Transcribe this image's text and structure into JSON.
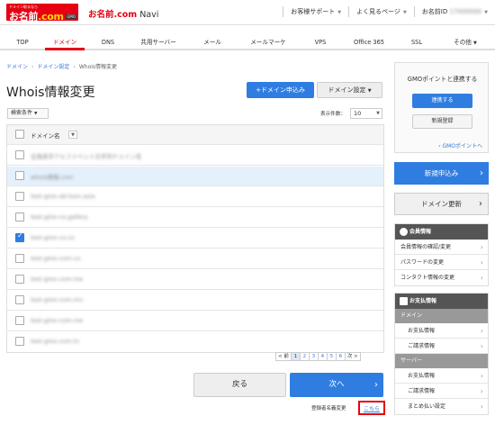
{
  "header": {
    "logo_tag": "ドメイン取るなら",
    "logo_main_a": "お名前",
    "logo_main_b": ".com",
    "logo_gmo": "GMO",
    "app_title_red": "お名前.com",
    "app_title_rest": " Navi",
    "links": [
      "お客様サポート",
      "よく見るページ",
      "お名前ID"
    ],
    "user_id": "17000000"
  },
  "nav": {
    "tabs": [
      "TOP",
      "ドメイン",
      "DNS",
      "共用サーバー",
      "メール",
      "メールマーケ",
      "VPS",
      "Office 365",
      "SSL",
      "その他"
    ],
    "active": "ドメイン"
  },
  "breadcrumb": [
    "ドメイン",
    "ドメイン設定",
    "Whois情報変更"
  ],
  "page_title": "Whois情報変更",
  "buttons": {
    "add_domain": "ドメイン申込み",
    "domain_settings": "ドメイン設定",
    "back": "戻る",
    "next": "次へ"
  },
  "filter": {
    "label": "検索条件",
    "count_label": "表示件数：",
    "count_value": "10"
  },
  "table": {
    "header": "ドメイン名",
    "rows": [
      {
        "name": "全角英字アルファベット文字列ドメイン名",
        "checked": false,
        "selected": false
      },
      {
        "name": "whois情報.com",
        "checked": false,
        "selected": true
      },
      {
        "name": "test-gmo-ab-tson.asia",
        "checked": false,
        "selected": false
      },
      {
        "name": "test-gmo-co.gallery",
        "checked": false,
        "selected": false
      },
      {
        "name": "test-gmo-co.co",
        "checked": true,
        "selected": false
      },
      {
        "name": "test-gmo-com.co",
        "checked": false,
        "selected": false
      },
      {
        "name": "test-gmo-com.me",
        "checked": false,
        "selected": false
      },
      {
        "name": "test-gmo-com.mn",
        "checked": false,
        "selected": false
      },
      {
        "name": "test-gmo-com.me",
        "checked": false,
        "selected": false
      },
      {
        "name": "test-gmo-com.tv",
        "checked": false,
        "selected": false
      }
    ]
  },
  "pagination": {
    "prev": "< 前",
    "pages": [
      "1",
      "2",
      "3",
      "4",
      "5",
      "6"
    ],
    "current": "1",
    "next": "次 >"
  },
  "change_note": "登録者名義変更",
  "change_link": "こちら",
  "sidebar": {
    "gmo_title": "GMOポイントと連携する",
    "gmo_link_btn": "連携する",
    "gmo_register_btn": "新規登録",
    "gmo_points_link": "› GMOポイントへ",
    "new_apply": "新規申込み",
    "domain_renew": "ドメイン更新",
    "member": {
      "title": "会員情報",
      "items": [
        "会員情報の確認/変更",
        "パスワードの変更",
        "コンタクト情報の変更"
      ]
    },
    "payment": {
      "title": "お支払情報",
      "domain_cat": "ドメイン",
      "domain_items": [
        "お支払情報",
        "ご請求情報"
      ],
      "server_cat": "サーバー",
      "server_items": [
        "お支払情報",
        "ご請求情報",
        "まとめ払い設定"
      ]
    }
  }
}
